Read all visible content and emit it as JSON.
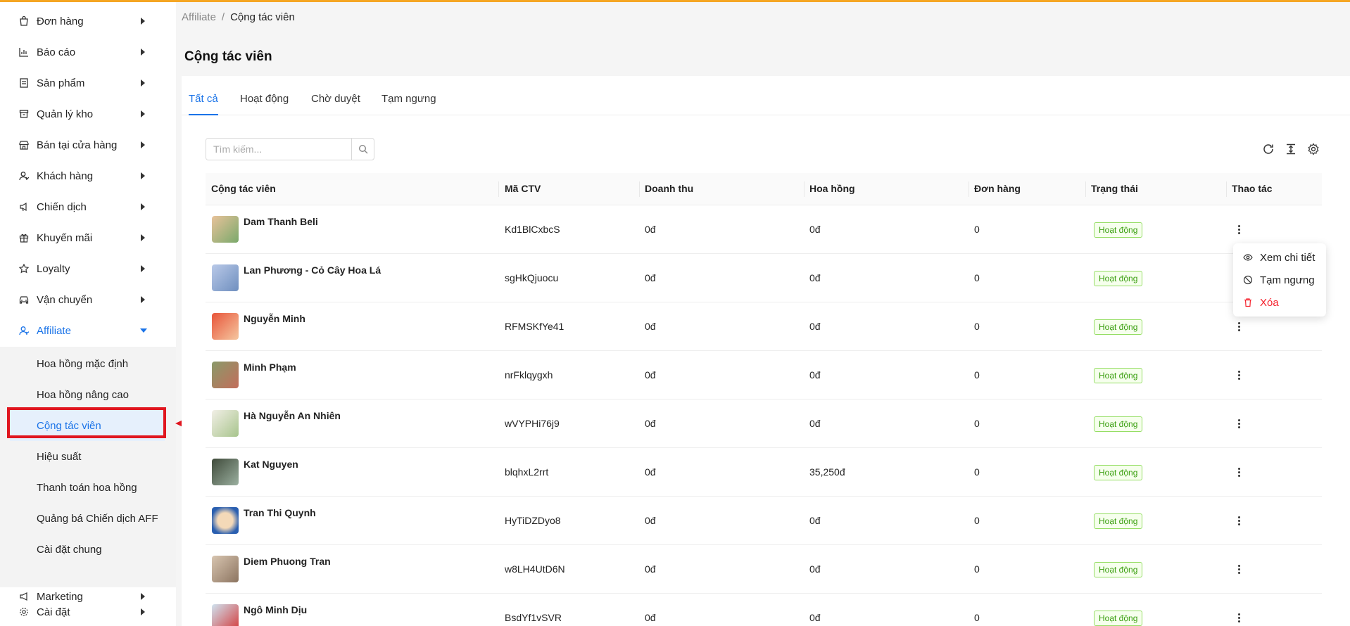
{
  "sidebar": {
    "items": [
      {
        "label": "Đơn hàng",
        "icon": "bag-icon"
      },
      {
        "label": "Báo cáo",
        "icon": "chart-icon"
      },
      {
        "label": "Sản phẩm",
        "icon": "product-icon"
      },
      {
        "label": "Quản lý kho",
        "icon": "warehouse-icon"
      },
      {
        "label": "Bán tại cửa hàng",
        "icon": "store-icon"
      },
      {
        "label": "Khách hàng",
        "icon": "customer-icon"
      },
      {
        "label": "Chiến dịch",
        "icon": "megaphone-icon"
      },
      {
        "label": "Khuyến mãi",
        "icon": "gift-icon"
      },
      {
        "label": "Loyalty",
        "icon": "star-icon"
      },
      {
        "label": "Vận chuyển",
        "icon": "car-icon"
      },
      {
        "label": "Affiliate",
        "icon": "affiliate-icon"
      }
    ],
    "affiliate_sub": [
      {
        "label": "Hoa hồng mặc định"
      },
      {
        "label": "Hoa hồng nâng cao"
      },
      {
        "label": "Cộng tác viên"
      },
      {
        "label": "Hiệu suất"
      },
      {
        "label": "Thanh toán hoa hồng"
      },
      {
        "label": "Quảng bá Chiến dịch AFF"
      },
      {
        "label": "Cài đặt chung"
      }
    ],
    "bottom": [
      {
        "label": "Marketing",
        "icon": "marketing-icon"
      },
      {
        "label": "Cài đặt",
        "icon": "gear-icon"
      }
    ]
  },
  "breadcrumb": {
    "parent": "Affiliate",
    "separator": "/",
    "current": "Cộng tác viên"
  },
  "page": {
    "title": "Cộng tác viên"
  },
  "tabs": [
    {
      "label": "Tất cả"
    },
    {
      "label": "Hoạt động"
    },
    {
      "label": "Chờ duyệt"
    },
    {
      "label": "Tạm ngưng"
    }
  ],
  "search": {
    "placeholder": "Tìm kiếm..."
  },
  "table": {
    "headers": [
      "Cộng tác viên",
      "Mã CTV",
      "Doanh thu",
      "Hoa hồng",
      "Đơn hàng",
      "Trạng thái",
      "Thao tác"
    ],
    "rows": [
      {
        "name": "Dam Thanh Beli",
        "code": "Kd1BlCxbcS",
        "revenue": "0đ",
        "commission": "0đ",
        "orders": "0",
        "status": "Hoạt động"
      },
      {
        "name": "Lan Phương - Cỏ Cây Hoa Lá",
        "code": "sgHkQjuocu",
        "revenue": "0đ",
        "commission": "0đ",
        "orders": "0",
        "status": "Hoạt động"
      },
      {
        "name": "Nguyễn Minh",
        "code": "RFMSKfYe41",
        "revenue": "0đ",
        "commission": "0đ",
        "orders": "0",
        "status": "Hoạt động"
      },
      {
        "name": "Minh Phạm",
        "code": "nrFklqygxh",
        "revenue": "0đ",
        "commission": "0đ",
        "orders": "0",
        "status": "Hoạt động"
      },
      {
        "name": "Hà Nguyễn An Nhiên",
        "code": "wVYPHi76j9",
        "revenue": "0đ",
        "commission": "0đ",
        "orders": "0",
        "status": "Hoạt động"
      },
      {
        "name": "Kat Nguyen",
        "code": "blqhxL2rrt",
        "revenue": "0đ",
        "commission": "35,250đ",
        "orders": "0",
        "status": "Hoạt động"
      },
      {
        "name": "Tran Thi Quynh",
        "code": "HyTiDZDyo8",
        "revenue": "0đ",
        "commission": "0đ",
        "orders": "0",
        "status": "Hoạt động"
      },
      {
        "name": "Diem Phuong Tran",
        "code": "w8LH4UtD6N",
        "revenue": "0đ",
        "commission": "0đ",
        "orders": "0",
        "status": "Hoạt động"
      },
      {
        "name": "Ngô Minh Dịu",
        "code": "BsdYf1vSVR",
        "revenue": "0đ",
        "commission": "0đ",
        "orders": "0",
        "status": "Hoạt động"
      }
    ]
  },
  "dropdown": {
    "view": "Xem chi tiết",
    "suspend": "Tạm ngưng",
    "delete": "Xóa"
  },
  "colors": {
    "accent": "#1a73e8",
    "highlight": "#e0161f",
    "success": "#389e0d",
    "danger": "#f5222d",
    "topbar": "#f5a623"
  }
}
